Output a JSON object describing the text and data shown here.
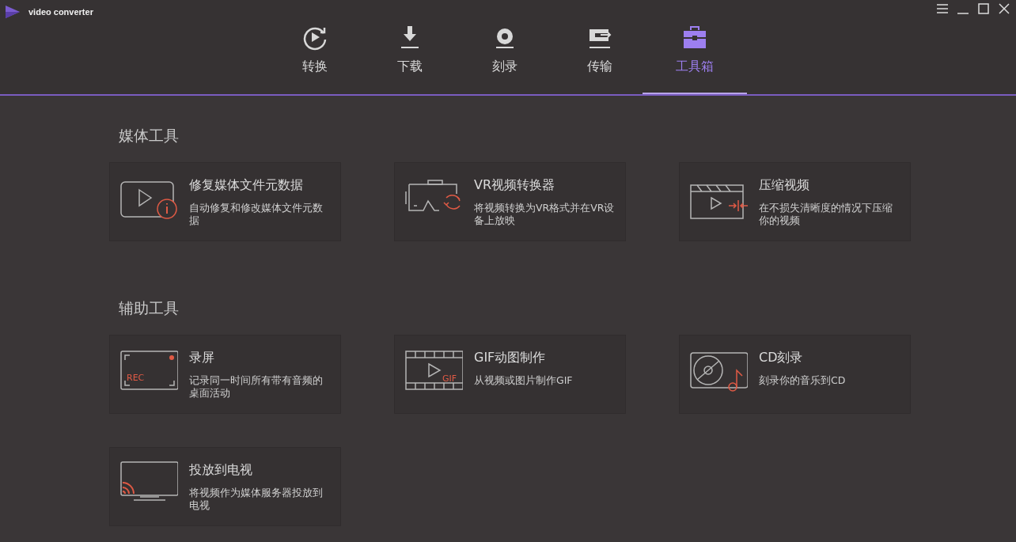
{
  "app": {
    "title": "video converter"
  },
  "tabs": [
    {
      "label": "转换",
      "kind": "convert",
      "selected": false
    },
    {
      "label": "下载",
      "kind": "download",
      "selected": false
    },
    {
      "label": "刻录",
      "kind": "burn",
      "selected": false
    },
    {
      "label": "传输",
      "kind": "transfer",
      "selected": false
    },
    {
      "label": "工具箱",
      "kind": "toolbox",
      "selected": true
    }
  ],
  "sections": [
    {
      "title": "媒体工具",
      "tools": [
        {
          "kind": "metadata",
          "title": "修复媒体文件元数据",
          "description": "自动修复和修改媒体文件元数据"
        },
        {
          "kind": "vr",
          "title": "VR视频转换器",
          "description": "将视频转换为VR格式并在VR设备上放映"
        },
        {
          "kind": "compress",
          "title": "压缩视频",
          "description": "在不损失清晰度的情况下压缩你的视频"
        }
      ]
    },
    {
      "title": "辅助工具",
      "tools": [
        {
          "kind": "record",
          "title": "录屏",
          "description": "记录同一时间所有带有音频的桌面活动",
          "badge": "REC"
        },
        {
          "kind": "gif",
          "title": "GIF动图制作",
          "description": "从视频或图片制作GIF",
          "badge": "GIF"
        },
        {
          "kind": "cd",
          "title": "CD刻录",
          "description": "刻录你的音乐到CD"
        },
        {
          "kind": "cast",
          "title": "投放到电视",
          "description": "将视频作为媒体服务器投放到电视"
        }
      ]
    }
  ]
}
